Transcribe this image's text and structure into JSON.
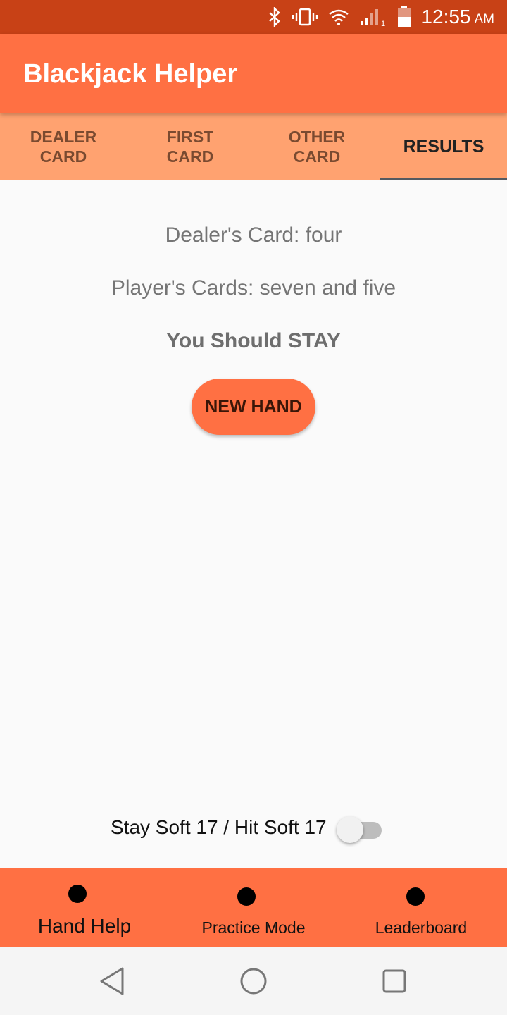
{
  "status_bar": {
    "time": "12:55",
    "ampm": "AM",
    "icons": [
      "bluetooth-icon",
      "vibrate-icon",
      "wifi-icon",
      "signal-icon",
      "battery-icon"
    ],
    "sim_slot": "1",
    "color": "#c84116"
  },
  "app_bar": {
    "title": "Blackjack Helper",
    "color": "#ff7043"
  },
  "tabs": [
    {
      "label": "DEALER\nCARD",
      "active": false
    },
    {
      "label": "FIRST\nCARD",
      "active": false
    },
    {
      "label": "OTHER\nCARD",
      "active": false
    },
    {
      "label": "RESULTS",
      "active": true
    }
  ],
  "results": {
    "dealer_card": "Dealer's Card: four",
    "player_cards": "Player's Cards: seven and five",
    "advice": "You Should STAY",
    "new_hand_label": "NEW HAND"
  },
  "toggle": {
    "label": "Stay Soft 17 / Hit Soft 17",
    "checked": false
  },
  "bottom_nav": [
    {
      "label": "Hand Help"
    },
    {
      "label": "Practice Mode"
    },
    {
      "label": "Leaderboard"
    }
  ],
  "system_nav": {
    "icons": [
      "back-icon",
      "home-icon",
      "recents-icon"
    ]
  },
  "colors": {
    "accent": "#ff7043",
    "tab_bar": "#ffa270",
    "indicator": "#555a60"
  }
}
